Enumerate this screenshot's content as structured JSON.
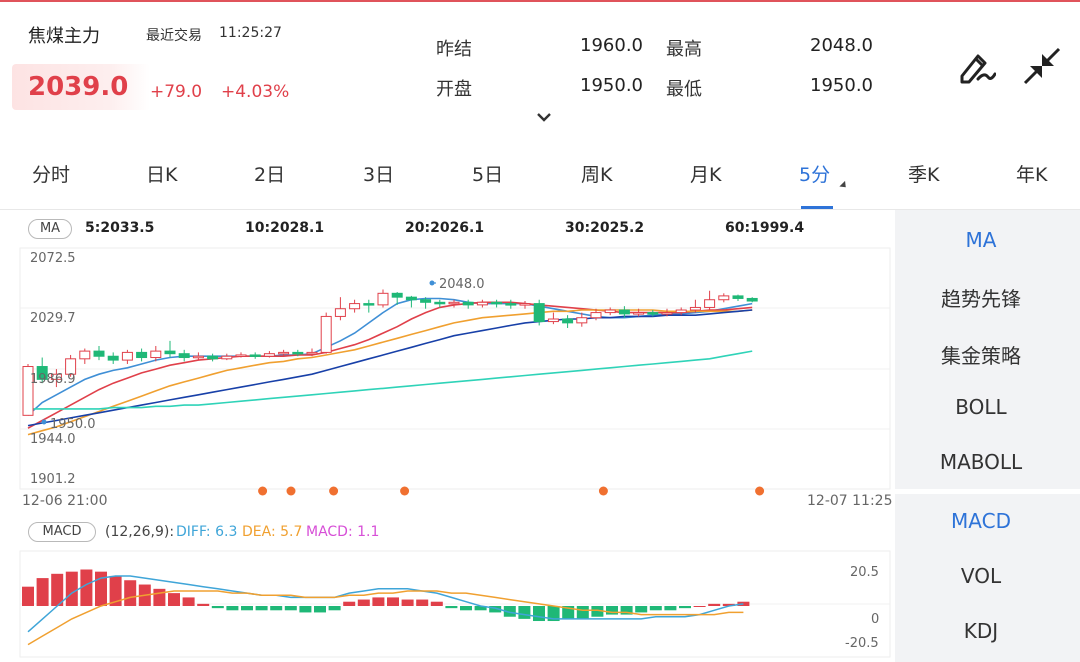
{
  "header": {
    "symbol": "焦煤主力",
    "trade_label": "最近交易",
    "trade_time": "11:25:27",
    "price": "2039.0",
    "change": "+79.0",
    "change_pct": "+4.03%",
    "quotes": [
      {
        "label": "昨结",
        "value": "1960.0"
      },
      {
        "label": "最高",
        "value": "2048.0"
      },
      {
        "label": "开盘",
        "value": "1950.0"
      },
      {
        "label": "最低",
        "value": "1950.0"
      }
    ]
  },
  "tabs": [
    "分时",
    "日K",
    "2日",
    "3日",
    "5日",
    "周K",
    "月K",
    "5分",
    "季K",
    "年K"
  ],
  "active_tab": "5分",
  "ma_legend": {
    "tag": "MA",
    "items": [
      {
        "label": "5:2033.5",
        "color": "#3f8fd6"
      },
      {
        "label": "10:2028.1",
        "color": "#e0404a"
      },
      {
        "label": "20:2026.1",
        "color": "#f0a030"
      },
      {
        "label": "30:2025.2",
        "color": "#1840a8"
      },
      {
        "label": "60:1999.4",
        "color": "#2fd3b8"
      }
    ]
  },
  "side_panel": {
    "main_items": [
      "MA",
      "趋势先锋",
      "集金策略",
      "BOLL",
      "MABOLL"
    ],
    "sub_items": [
      "MACD",
      "VOL",
      "KDJ"
    ],
    "active_main": "MA",
    "active_sub": "MACD"
  },
  "price_axis": [
    "2072.5",
    "2029.7",
    "1986.9",
    "1944.0",
    "1901.2"
  ],
  "annotations": {
    "high": "2048.0",
    "low": "1950.0"
  },
  "time_axis": {
    "start": "12-06 21:00",
    "end": "12-07 11:25"
  },
  "macd_legend": {
    "tag": "MACD",
    "params": "(12,26,9):",
    "diff": "DIFF: 6.3",
    "dea": "DEA: 5.7",
    "macd": "MACD: 1.1"
  },
  "macd_axis": [
    "20.5",
    "0",
    "-20.5"
  ],
  "colors": {
    "up": "#e0404a",
    "down": "#1fb877",
    "accent": "#2e73d8",
    "marker": "#f07030"
  },
  "chart_data": [
    {
      "type": "candlestick",
      "price_range": [
        1901.2,
        2072.5
      ],
      "candles": [
        [
          1950,
          1988,
          1950,
          1990
        ],
        [
          1988,
          1978,
          1975,
          1995
        ],
        [
          1978,
          1982,
          1972,
          1986
        ],
        [
          1982,
          1994,
          1980,
          1997
        ],
        [
          1994,
          2000,
          1990,
          2002
        ],
        [
          2000,
          1996,
          1993,
          2004
        ],
        [
          1996,
          1993,
          1990,
          1999
        ],
        [
          1993,
          1999,
          1990,
          2001
        ],
        [
          1999,
          1995,
          1992,
          2002
        ],
        [
          1995,
          2000,
          1992,
          2004
        ],
        [
          2000,
          1998,
          1995,
          2008
        ],
        [
          1998,
          1995,
          1992,
          2001
        ],
        [
          1995,
          1996,
          1993,
          1999
        ],
        [
          1996,
          1994,
          1992,
          1998
        ],
        [
          1994,
          1996,
          1993,
          1998
        ],
        [
          1996,
          1997,
          1995,
          1999
        ],
        [
          1997,
          1996,
          1994,
          1999
        ],
        [
          1996,
          1998,
          1995,
          2000
        ],
        [
          1998,
          1999,
          1996,
          2001
        ],
        [
          1999,
          1998,
          1996,
          2001
        ],
        [
          1998,
          1999,
          1996,
          2002
        ],
        [
          1999,
          2027,
          1998,
          2030
        ],
        [
          2027,
          2033,
          2024,
          2042
        ],
        [
          2033,
          2037,
          2030,
          2040
        ],
        [
          2037,
          2036,
          2030,
          2040
        ],
        [
          2036,
          2045,
          2034,
          2048
        ],
        [
          2045,
          2042,
          2036,
          2046
        ],
        [
          2042,
          2040,
          2034,
          2043
        ],
        [
          2040,
          2038,
          2033,
          2042
        ],
        [
          2038,
          2037,
          2034,
          2040
        ],
        [
          2037,
          2038,
          2034,
          2040
        ],
        [
          2038,
          2036,
          2033,
          2040
        ],
        [
          2036,
          2038,
          2034,
          2040
        ],
        [
          2038,
          2037,
          2034,
          2040
        ],
        [
          2037,
          2036,
          2033,
          2040
        ],
        [
          2036,
          2037,
          2033,
          2039
        ],
        [
          2037,
          2023,
          2020,
          2040
        ],
        [
          2023,
          2025,
          2021,
          2030
        ],
        [
          2025,
          2022,
          2018,
          2028
        ],
        [
          2022,
          2026,
          2019,
          2030
        ],
        [
          2026,
          2030,
          2024,
          2033
        ],
        [
          2030,
          2032,
          2028,
          2034
        ],
        [
          2032,
          2029,
          2026,
          2035
        ],
        [
          2029,
          2030,
          2027,
          2033
        ],
        [
          2030,
          2029,
          2027,
          2032
        ],
        [
          2029,
          2030,
          2027,
          2033
        ],
        [
          2030,
          2032,
          2028,
          2034
        ],
        [
          2032,
          2034,
          2030,
          2040
        ],
        [
          2034,
          2040,
          2032,
          2047
        ],
        [
          2040,
          2043,
          2038,
          2045
        ],
        [
          2043,
          2041,
          2039,
          2044
        ],
        [
          2041,
          2039,
          2038,
          2042
        ]
      ],
      "moving_averages": [
        {
          "name": "MA5",
          "color": "#3f8fd6",
          "values": [
            1950,
            1960,
            1966,
            1972,
            1978,
            1982,
            1985,
            1987,
            1990,
            1993,
            1995,
            1996,
            1996,
            1996,
            1996,
            1996,
            1996,
            1996,
            1997,
            1997,
            1998,
            2003,
            2008,
            2014,
            2022,
            2030,
            2037,
            2040,
            2041,
            2041,
            2040,
            2038,
            2037,
            2037,
            2037,
            2037,
            2035,
            2033,
            2031,
            2029,
            2027,
            2026,
            2026,
            2027,
            2028,
            2029,
            2029,
            2030,
            2031,
            2033,
            2035,
            2037
          ]
        },
        {
          "name": "MA10",
          "color": "#e0404a",
          "values": [
            1940,
            1946,
            1952,
            1958,
            1964,
            1970,
            1975,
            1979,
            1983,
            1986,
            1989,
            1991,
            1993,
            1994,
            1995,
            1996,
            1996,
            1996,
            1996,
            1997,
            1997,
            1999,
            2002,
            2005,
            2009,
            2014,
            2019,
            2025,
            2030,
            2034,
            2036,
            2037,
            2038,
            2038,
            2038,
            2037,
            2036,
            2035,
            2034,
            2033,
            2032,
            2031,
            2030,
            2030,
            2030,
            2030,
            2030,
            2031,
            2032,
            2032,
            2033,
            2034
          ]
        },
        {
          "name": "MA20",
          "color": "#f0a030",
          "values": [
            1935,
            1938,
            1941,
            1945,
            1949,
            1953,
            1957,
            1961,
            1965,
            1969,
            1973,
            1976,
            1979,
            1982,
            1985,
            1987,
            1989,
            1991,
            1992,
            1994,
            1995,
            1997,
            1999,
            2001,
            2004,
            2007,
            2010,
            2013,
            2016,
            2019,
            2022,
            2024,
            2026,
            2027,
            2028,
            2029,
            2030,
            2031,
            2031,
            2032,
            2032,
            2032,
            2032,
            2032,
            2032,
            2031,
            2031,
            2031,
            2031,
            2031,
            2031,
            2032
          ]
        },
        {
          "name": "MA30",
          "color": "#1840a8",
          "values": [
            1942,
            1944,
            1946,
            1948,
            1950,
            1952,
            1954,
            1956,
            1958,
            1960,
            1962,
            1964,
            1966,
            1968,
            1970,
            1972,
            1974,
            1976,
            1978,
            1980,
            1982,
            1985,
            1988,
            1991,
            1994,
            1997,
            2000,
            2003,
            2006,
            2009,
            2012,
            2014,
            2016,
            2018,
            2020,
            2022,
            2023,
            2024,
            2025,
            2025,
            2026,
            2026,
            2027,
            2027,
            2027,
            2028,
            2028,
            2028,
            2029,
            2030,
            2031,
            2032
          ]
        },
        {
          "name": "MA60",
          "color": "#2fd3b8",
          "values": [
            1955,
            1955,
            1955,
            1955,
            1955,
            1955,
            1956,
            1956,
            1956,
            1957,
            1957,
            1958,
            1958,
            1959,
            1960,
            1961,
            1962,
            1963,
            1964,
            1965,
            1966,
            1967,
            1968,
            1969,
            1970,
            1971,
            1972,
            1973,
            1974,
            1975,
            1976,
            1977,
            1978,
            1979,
            1980,
            1981,
            1982,
            1983,
            1984,
            1985,
            1986,
            1987,
            1988,
            1989,
            1990,
            1991,
            1992,
            1993,
            1994,
            1996,
            1998,
            2000
          ]
        }
      ],
      "marker_indices": [
        13,
        15,
        18,
        23,
        37,
        48
      ]
    },
    {
      "type": "bar",
      "name": "MACD",
      "ylim": [
        -20.5,
        20.5
      ],
      "values": [
        9,
        13,
        15,
        16,
        17,
        16,
        14,
        12,
        10,
        8,
        6,
        4,
        1,
        -1,
        -2,
        -2,
        -2,
        -2,
        -2,
        -3,
        -3,
        -2,
        2,
        3,
        4,
        4,
        3,
        3,
        2,
        -1,
        -2,
        -2,
        -3,
        -5,
        -6,
        -7,
        -7,
        -6,
        -6,
        -5,
        -4,
        -4,
        -3,
        -2,
        -2,
        -1,
        0,
        1,
        1,
        2
      ],
      "diff": [
        -12,
        -6,
        0,
        6,
        10,
        13,
        14,
        14,
        13,
        12,
        11,
        10,
        9,
        8,
        7,
        6,
        5,
        5,
        4,
        4,
        4,
        4,
        6,
        7,
        8,
        8,
        8,
        7,
        6,
        4,
        2,
        0,
        -1,
        -3,
        -4,
        -5,
        -6,
        -6,
        -6,
        -6,
        -6,
        -6,
        -6,
        -5,
        -5,
        -5,
        -4,
        -2,
        0,
        1
      ],
      "dea": [
        -18,
        -14,
        -10,
        -6,
        -3,
        0,
        2,
        4,
        5,
        6,
        7,
        7,
        7,
        7,
        6,
        6,
        5,
        5,
        5,
        4,
        4,
        4,
        5,
        5,
        6,
        6,
        7,
        7,
        7,
        6,
        6,
        5,
        4,
        3,
        2,
        1,
        0,
        -1,
        -2,
        -2,
        -3,
        -3,
        -4,
        -4,
        -4,
        -4,
        -4,
        -4,
        -3,
        -3
      ]
    }
  ]
}
